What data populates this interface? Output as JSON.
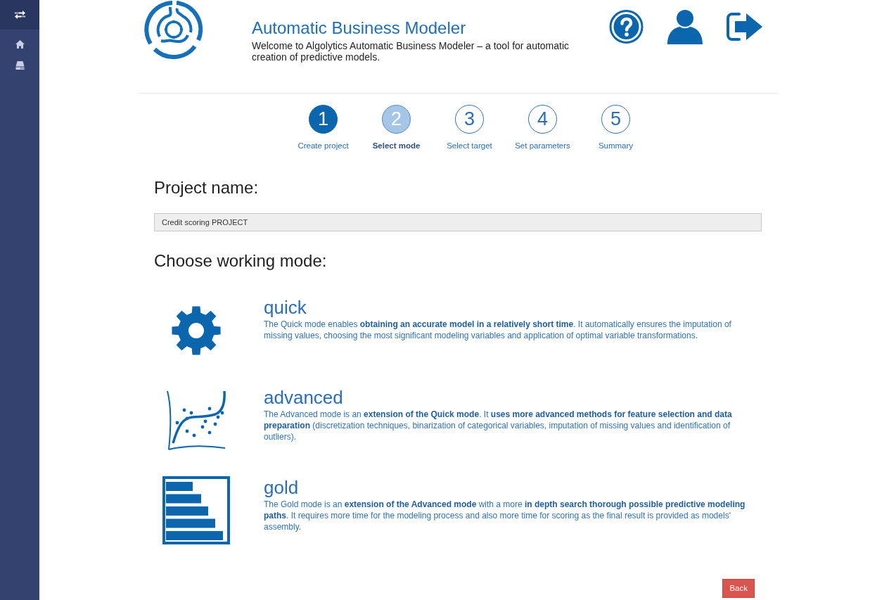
{
  "header": {
    "title": "Automatic Business Modeler",
    "subtitle": "Welcome to Algolytics Automatic Business Modeler – a tool for automatic creation of predictive models."
  },
  "steps": [
    {
      "number": "1",
      "label": "Create project",
      "completed": true,
      "selected": false
    },
    {
      "number": "2",
      "label": "Select mode",
      "completed": false,
      "selected": true
    },
    {
      "number": "3",
      "label": "Select target",
      "completed": false,
      "selected": false
    },
    {
      "number": "4",
      "label": "Set parameters",
      "completed": false,
      "selected": false
    },
    {
      "number": "5",
      "label": "Summary",
      "completed": false,
      "selected": false
    }
  ],
  "project_name": {
    "label": "Project name:",
    "value": "Credit scoring PROJECT",
    "disabled": true
  },
  "working_mode": {
    "heading": "Choose working mode:",
    "modes": [
      {
        "kind": "gear",
        "title": "quick",
        "description": "The Quick mode enables **obtaining an accurate model in a relatively short time**. It automatically ensures the imputation of missing values, choosing the most significant modeling variables and application of optimal variable transformations."
      },
      {
        "kind": "scatter",
        "title": "advanced",
        "description": "The Advanced mode is an **extension of the Quick mode**. It **uses more advanced methods for feature selection and data preparation** (discretization techniques, binarization of categorical variables, imputation of missing values and identification of outliers)."
      },
      {
        "kind": "bars",
        "title": "gold",
        "description": "The Gold mode is an **extension of the Advanced mode** with a more **in depth search thorough possible predictive modeling paths**. It requires more time for the modeling process and also more time for scoring as the final result is provided as models' assembly."
      }
    ]
  },
  "buttons": [
    {
      "label": "Back"
    }
  ]
}
